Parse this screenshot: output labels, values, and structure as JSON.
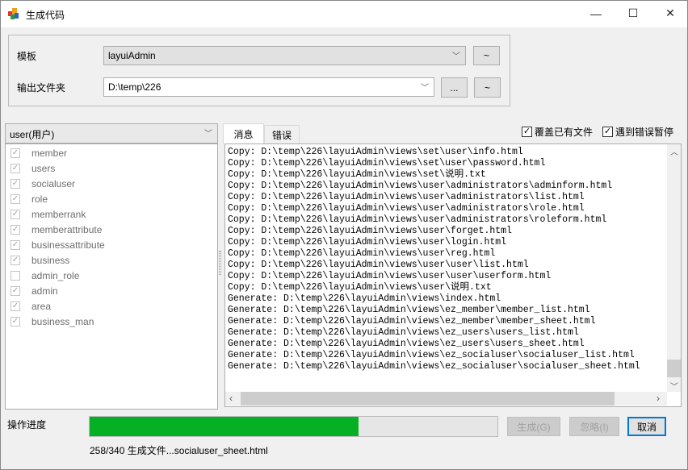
{
  "window": {
    "title": "生成代码",
    "icon": "app-icon",
    "minimize": "—",
    "maximize": "☐",
    "close": "✕"
  },
  "form": {
    "template_label": "模板",
    "template_value": "layuiAdmin",
    "template_extra": "~",
    "output_label": "输出文件夹",
    "output_value": "D:\\temp\\226",
    "browse": "...",
    "output_extra": "~"
  },
  "table_combo": "user(用户)",
  "tables": [
    {
      "name": "member",
      "checked": true
    },
    {
      "name": "users",
      "checked": true
    },
    {
      "name": "socialuser",
      "checked": true
    },
    {
      "name": "role",
      "checked": true
    },
    {
      "name": "memberrank",
      "checked": true
    },
    {
      "name": "memberattribute",
      "checked": true
    },
    {
      "name": "businessattribute",
      "checked": true
    },
    {
      "name": "business",
      "checked": true
    },
    {
      "name": "admin_role",
      "checked": false
    },
    {
      "name": "admin",
      "checked": true
    },
    {
      "name": "area",
      "checked": true
    },
    {
      "name": "business_man",
      "checked": true
    }
  ],
  "tabs": [
    {
      "label": "消息",
      "active": true
    },
    {
      "label": "错误",
      "active": false
    }
  ],
  "options": {
    "overwrite": {
      "label": "覆盖已有文件",
      "checked": true
    },
    "pause_on_error": {
      "label": "遇到错误暂停",
      "checked": true
    }
  },
  "log": [
    "Copy: D:\\temp\\226\\layuiAdmin\\views\\set\\user\\info.html",
    "Copy: D:\\temp\\226\\layuiAdmin\\views\\set\\user\\password.html",
    "Copy: D:\\temp\\226\\layuiAdmin\\views\\set\\说明.txt",
    "Copy: D:\\temp\\226\\layuiAdmin\\views\\user\\administrators\\adminform.html",
    "Copy: D:\\temp\\226\\layuiAdmin\\views\\user\\administrators\\list.html",
    "Copy: D:\\temp\\226\\layuiAdmin\\views\\user\\administrators\\role.html",
    "Copy: D:\\temp\\226\\layuiAdmin\\views\\user\\administrators\\roleform.html",
    "Copy: D:\\temp\\226\\layuiAdmin\\views\\user\\forget.html",
    "Copy: D:\\temp\\226\\layuiAdmin\\views\\user\\login.html",
    "Copy: D:\\temp\\226\\layuiAdmin\\views\\user\\reg.html",
    "Copy: D:\\temp\\226\\layuiAdmin\\views\\user\\user\\list.html",
    "Copy: D:\\temp\\226\\layuiAdmin\\views\\user\\user\\userform.html",
    "Copy: D:\\temp\\226\\layuiAdmin\\views\\user\\说明.txt",
    "Generate: D:\\temp\\226\\layuiAdmin\\views\\index.html",
    "Generate: D:\\temp\\226\\layuiAdmin\\views\\ez_member\\member_list.html",
    "Generate: D:\\temp\\226\\layuiAdmin\\views\\ez_member\\member_sheet.html",
    "Generate: D:\\temp\\226\\layuiAdmin\\views\\ez_users\\users_list.html",
    "Generate: D:\\temp\\226\\layuiAdmin\\views\\ez_users\\users_sheet.html",
    "Generate: D:\\temp\\226\\layuiAdmin\\views\\ez_socialuser\\socialuser_list.html",
    "Generate: D:\\temp\\226\\layuiAdmin\\views\\ez_socialuser\\socialuser_sheet.html"
  ],
  "progress": {
    "label": "操作进度",
    "fill_fraction": 0.66,
    "status": "258/340 生成文件...socialuser_sheet.html",
    "color": "#06b025"
  },
  "buttons": {
    "generate": "生成(G)",
    "ignore": "忽略(I)",
    "cancel": "取消"
  },
  "colors": {
    "accent": "#0078d7"
  }
}
